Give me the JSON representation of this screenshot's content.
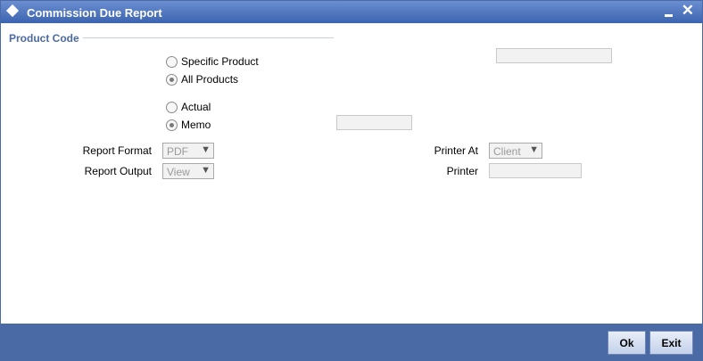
{
  "window": {
    "title": "Commission Due Report"
  },
  "section": {
    "title": "Product Code"
  },
  "product": {
    "specific_label": "Specific Product",
    "all_label": "All Products",
    "selected": "All Products"
  },
  "mode": {
    "actual_label": "Actual",
    "memo_label": "Memo",
    "selected": "Memo"
  },
  "report": {
    "format_label": "Report Format",
    "format_value": "PDF",
    "output_label": "Report Output",
    "output_value": "View",
    "printer_at_label": "Printer At",
    "printer_at_value": "Client",
    "printer_label": "Printer"
  },
  "buttons": {
    "ok": "Ok",
    "exit": "Exit"
  },
  "colors": {
    "titlebar": "#3c64b0",
    "footer": "#4a6aa5",
    "section_title": "#4a6aa5"
  }
}
